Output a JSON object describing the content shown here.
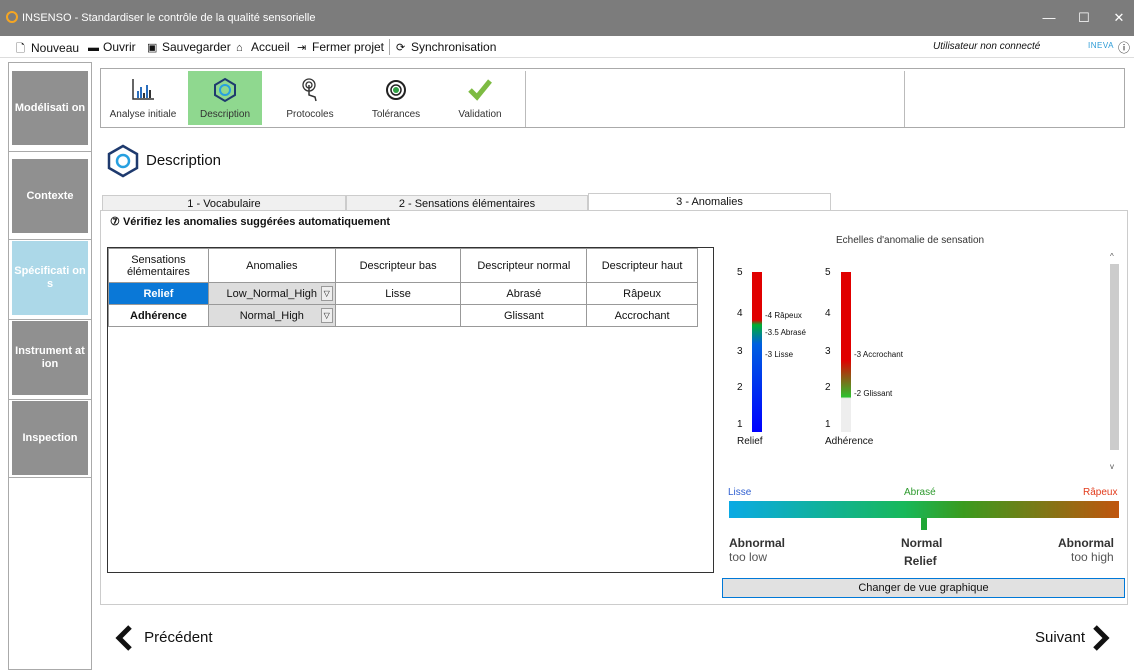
{
  "window": {
    "title": "INSENSO - Standardiser le contrôle de la qualité sensorielle",
    "minimize_icon": "minimize-icon",
    "maximize_icon": "maximize-icon",
    "close_icon": "close-icon"
  },
  "menu": {
    "items": [
      {
        "label": "Nouveau",
        "icon": "new-file-icon"
      },
      {
        "label": "Ouvrir",
        "icon": "open-folder-icon"
      },
      {
        "label": "Sauvegarder",
        "icon": "save-icon"
      },
      {
        "label": "Accueil",
        "icon": "home-icon"
      },
      {
        "label": "Fermer projet",
        "icon": "close-project-icon"
      },
      {
        "label": "Synchronisation",
        "icon": "sync-icon"
      }
    ],
    "user_status": "Utilisateur non connecté",
    "brand": "INEVA",
    "info_symbol": "ⓘ"
  },
  "sidebar": {
    "items": [
      {
        "label": "Modélisati on",
        "active": false
      },
      {
        "label": "Contexte",
        "active": false
      },
      {
        "label": "Spécificati ons",
        "active": true
      },
      {
        "label": "Instrument ation",
        "active": false
      },
      {
        "label": "Inspection",
        "active": false
      }
    ]
  },
  "steps": [
    {
      "label": "Analyse initiale",
      "icon": "chart-icon",
      "active": false
    },
    {
      "label": "Description",
      "icon": "description-icon",
      "active": true
    },
    {
      "label": "Protocoles",
      "icon": "touch-icon",
      "active": false
    },
    {
      "label": "Tolérances",
      "icon": "target-icon",
      "active": false
    },
    {
      "label": "Validation",
      "icon": "checkmark-icon",
      "active": false
    }
  ],
  "page_title": "Description",
  "tabs": [
    {
      "label": "1 - Vocabulaire",
      "selected": false
    },
    {
      "label": "2 - Sensations élémentaires",
      "selected": false
    },
    {
      "label": "3 - Anomalies",
      "selected": true
    }
  ],
  "instruction": "Vérifiez les anomalies suggérées automatiquement",
  "instruction_icon": "⑦",
  "table": {
    "headers": [
      "Sensations élémentaires",
      "Anomalies",
      "Descripteur bas",
      "Descripteur normal",
      "Descripteur haut"
    ],
    "rows": [
      {
        "sensation": "Relief",
        "anomalie": "Low_Normal_High",
        "bas": "Lisse",
        "normal": "Abrasé",
        "haut": "Râpeux",
        "selected": true
      },
      {
        "sensation": "Adhérence",
        "anomalie": "Normal_High",
        "bas": "",
        "normal": "Glissant",
        "haut": "Accrochant",
        "selected": false
      }
    ]
  },
  "scales": {
    "title": "Echelles d'anomalie de sensation",
    "ticks": [
      "5",
      "4",
      "3",
      "2",
      "1"
    ],
    "relief": {
      "name": "Relief",
      "annotations": [
        "-4 Râpeux",
        "-3.5 Abrasé",
        "-3 Lisse"
      ]
    },
    "adherence": {
      "name": "Adhérence",
      "annotations": [
        "-3 Accrochant",
        "-2 Glissant"
      ]
    }
  },
  "gradient": {
    "low": "Lisse",
    "mid": "Abrasé",
    "high": "Râpeux",
    "colors": {
      "low": "#2f5fd0",
      "mid": "#2d9a2d",
      "high": "#e23b1b"
    },
    "abnormal_low": "Abnormal",
    "abnormal_low_sub": "too low",
    "normal": "Normal",
    "normal_sub": "Relief",
    "abnormal_high": "Abnormal",
    "abnormal_high_sub": "too high"
  },
  "change_view_button": "Changer de vue graphique",
  "nav": {
    "prev": "Précédent",
    "next": "Suivant"
  }
}
